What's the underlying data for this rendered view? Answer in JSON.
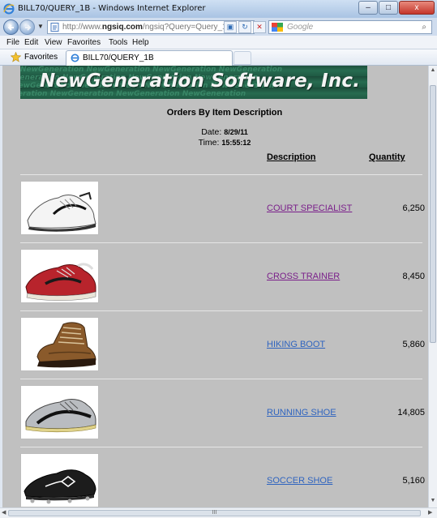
{
  "window": {
    "title": "BILL70/QUERY_1B - Windows Internet Explorer",
    "minimize_glyph": "–",
    "maximize_glyph": "□",
    "close_glyph": "x"
  },
  "address_bar": {
    "url_prefix": "http://www.",
    "url_domain": "ngsiq.com",
    "url_rest": "/ngsiq?Query=Query_1",
    "search_placeholder": "Google",
    "search_icon_glyph": "⌕"
  },
  "menu": {
    "items": [
      "File",
      "Edit",
      "View",
      "Favorites",
      "Tools",
      "Help"
    ]
  },
  "favorites_bar": {
    "favorites_label": "Favorites",
    "tab_label": "BILL70/QUERY_1B"
  },
  "report": {
    "logo_text": "NewGeneration Software, Inc.",
    "logo_background_text": "NewGeneration NewGeneration NewGeneration NewGeneration",
    "title": "Orders By Item Description",
    "date_label": "Date:",
    "date_value": "8/29/11",
    "time_label": "Time:",
    "time_value": "15:55:12",
    "column_description": "Description",
    "column_quantity": "Quantity",
    "link_visited_color": "#7a1f8a",
    "link_unvisited_color": "#2f64bf",
    "rows": [
      {
        "description": "COURT SPECIALIST",
        "quantity": "6,250",
        "visited": true,
        "image": "court-specialist-shoe"
      },
      {
        "description": "CROSS TRAINER",
        "quantity": "8,450",
        "visited": true,
        "image": "cross-trainer-shoe"
      },
      {
        "description": "HIKING BOOT",
        "quantity": "5,860",
        "visited": false,
        "image": "hiking-boot"
      },
      {
        "description": "RUNNING SHOE",
        "quantity": "14,805",
        "visited": false,
        "image": "running-shoe"
      },
      {
        "description": "SOCCER SHOE",
        "quantity": "5,160",
        "visited": false,
        "image": "soccer-shoe"
      }
    ]
  },
  "scrollbar": {
    "h_thumb_grip": "III"
  }
}
